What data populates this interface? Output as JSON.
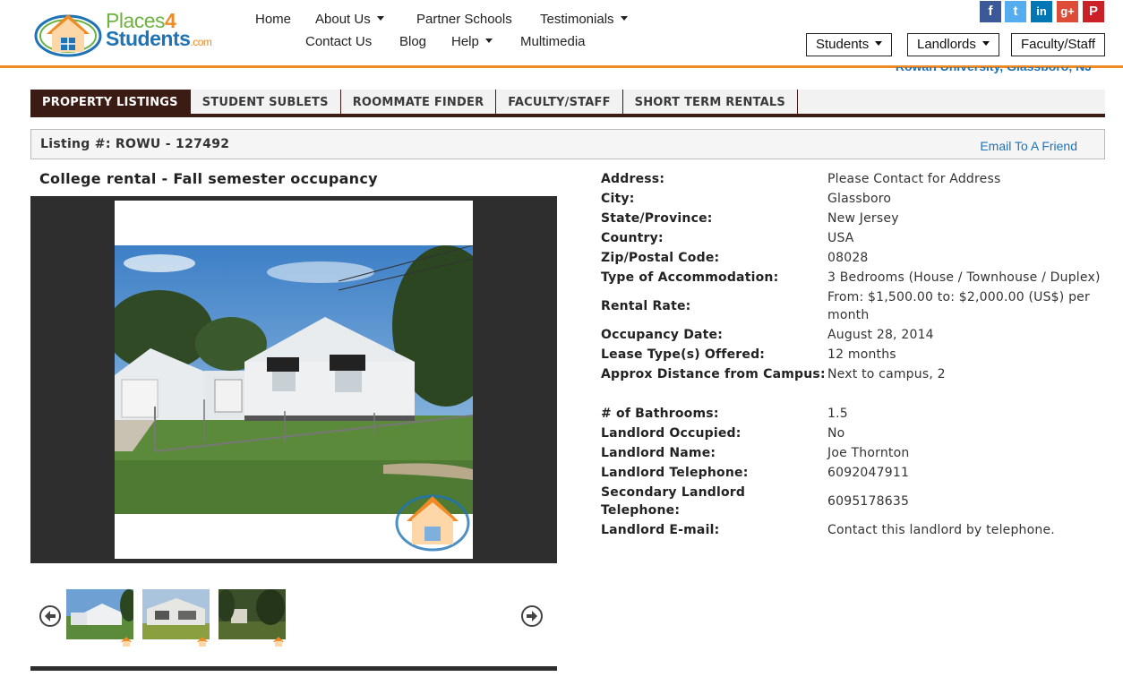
{
  "header": {
    "logo": {
      "text_main": "Places",
      "text_four": "4",
      "text_students": "Students",
      "text_com": ".com"
    },
    "nav": {
      "home": "Home",
      "about": "About Us",
      "partner_schools": "Partner Schools",
      "testimonials": "Testimonials",
      "contact": "Contact Us",
      "blog": "Blog",
      "help": "Help",
      "multimedia": "Multimedia"
    },
    "social": {
      "facebook": "f",
      "twitter": "t",
      "linkedin": "in",
      "googleplus": "g+",
      "pinterest": "P"
    },
    "buttons": {
      "students": "Students",
      "landlords": "Landlords",
      "faculty_staff": "Faculty/Staff"
    },
    "location": "Rowan University, Glassboro, NJ"
  },
  "tabs": [
    "PROPERTY LISTINGS",
    "STUDENT SUBLETS",
    "ROOMMATE FINDER",
    "FACULTY/STAFF",
    "SHORT TERM RENTALS"
  ],
  "listing": {
    "id_label": "Listing #: ROWU - 127492",
    "email_friend": "Email To A Friend",
    "title": "College rental - Fall semester occupancy"
  },
  "details": [
    {
      "label": "Address:",
      "value": "Please Contact for Address"
    },
    {
      "label": "City:",
      "value": "Glassboro"
    },
    {
      "label": "State/Province:",
      "value": "New Jersey"
    },
    {
      "label": "Country:",
      "value": "USA"
    },
    {
      "label": "Zip/Postal Code:",
      "value": "08028"
    },
    {
      "label": "Type of Accommodation:",
      "value": "3 Bedrooms (House / Townhouse / Duplex)"
    },
    {
      "label": "Rental Rate:",
      "value": "From: $1,500.00 to: $2,000.00 (US$) per month"
    },
    {
      "label": "Occupancy Date:",
      "value": "August 28, 2014"
    },
    {
      "label": "Lease Type(s) Offered:",
      "value": "12 months"
    },
    {
      "label": "Approx Distance from Campus:",
      "value": "Next to campus, 2"
    },
    {
      "label": "# of Bathrooms:",
      "value": "1.5"
    },
    {
      "label": "Landlord Occupied:",
      "value": "No"
    },
    {
      "label": "Landlord Name:",
      "value": "Joe Thornton"
    },
    {
      "label": "Landlord Telephone:",
      "value": "6092047911"
    },
    {
      "label": "Secondary Landlord Telephone:",
      "value": "6095178635"
    },
    {
      "label": "Landlord E-mail:",
      "value": "Contact this landlord by telephone."
    }
  ],
  "colors": {
    "accent_orange": "#f08a24",
    "link_blue": "#1f73b7",
    "tab_dark": "#3a1c14",
    "logo_green": "#6cb33f"
  }
}
